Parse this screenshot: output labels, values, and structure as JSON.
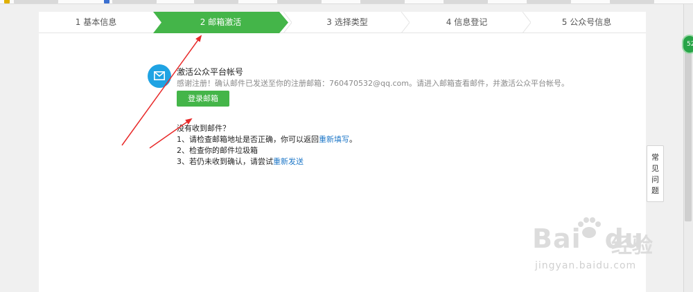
{
  "steps": [
    {
      "label": "1 基本信息",
      "active": false
    },
    {
      "label": "2 邮箱激活",
      "active": true
    },
    {
      "label": "3 选择类型",
      "active": false
    },
    {
      "label": "4 信息登记",
      "active": false
    },
    {
      "label": "5 公众号信息",
      "active": false
    }
  ],
  "content": {
    "title": "激活公众平台帐号",
    "description": "感谢注册！确认邮件已发送至你的注册邮箱：760470532@qq.com。请进入邮箱查看邮件，并激活公众平台帐号。",
    "login_button": "登录邮箱"
  },
  "help": {
    "question": "没有收到邮件？",
    "item1_prefix": "1、请检查邮箱地址是否正确，你可以返回",
    "item1_link": "重新填写",
    "item1_suffix": "。",
    "item2": "2、检查你的邮件垃圾箱",
    "item3_prefix": "3、若仍未收到确认，请尝试",
    "item3_link": "重新发送"
  },
  "faq": {
    "chars": [
      "常",
      "见",
      "问",
      "题"
    ]
  },
  "float_badge": "52",
  "watermark": {
    "logo_text": "Bai",
    "logo_text_tail": "du",
    "logo_cn": "经验",
    "url": "jingyan.baidu.com"
  },
  "colors": {
    "active_step": "#44b549",
    "mail_badge": "#1fa3e3",
    "link": "#1f78c8",
    "arrow": "#e82a2a"
  },
  "icons": {
    "mail": "envelope-icon",
    "baidu_paw": "paw-icon"
  }
}
